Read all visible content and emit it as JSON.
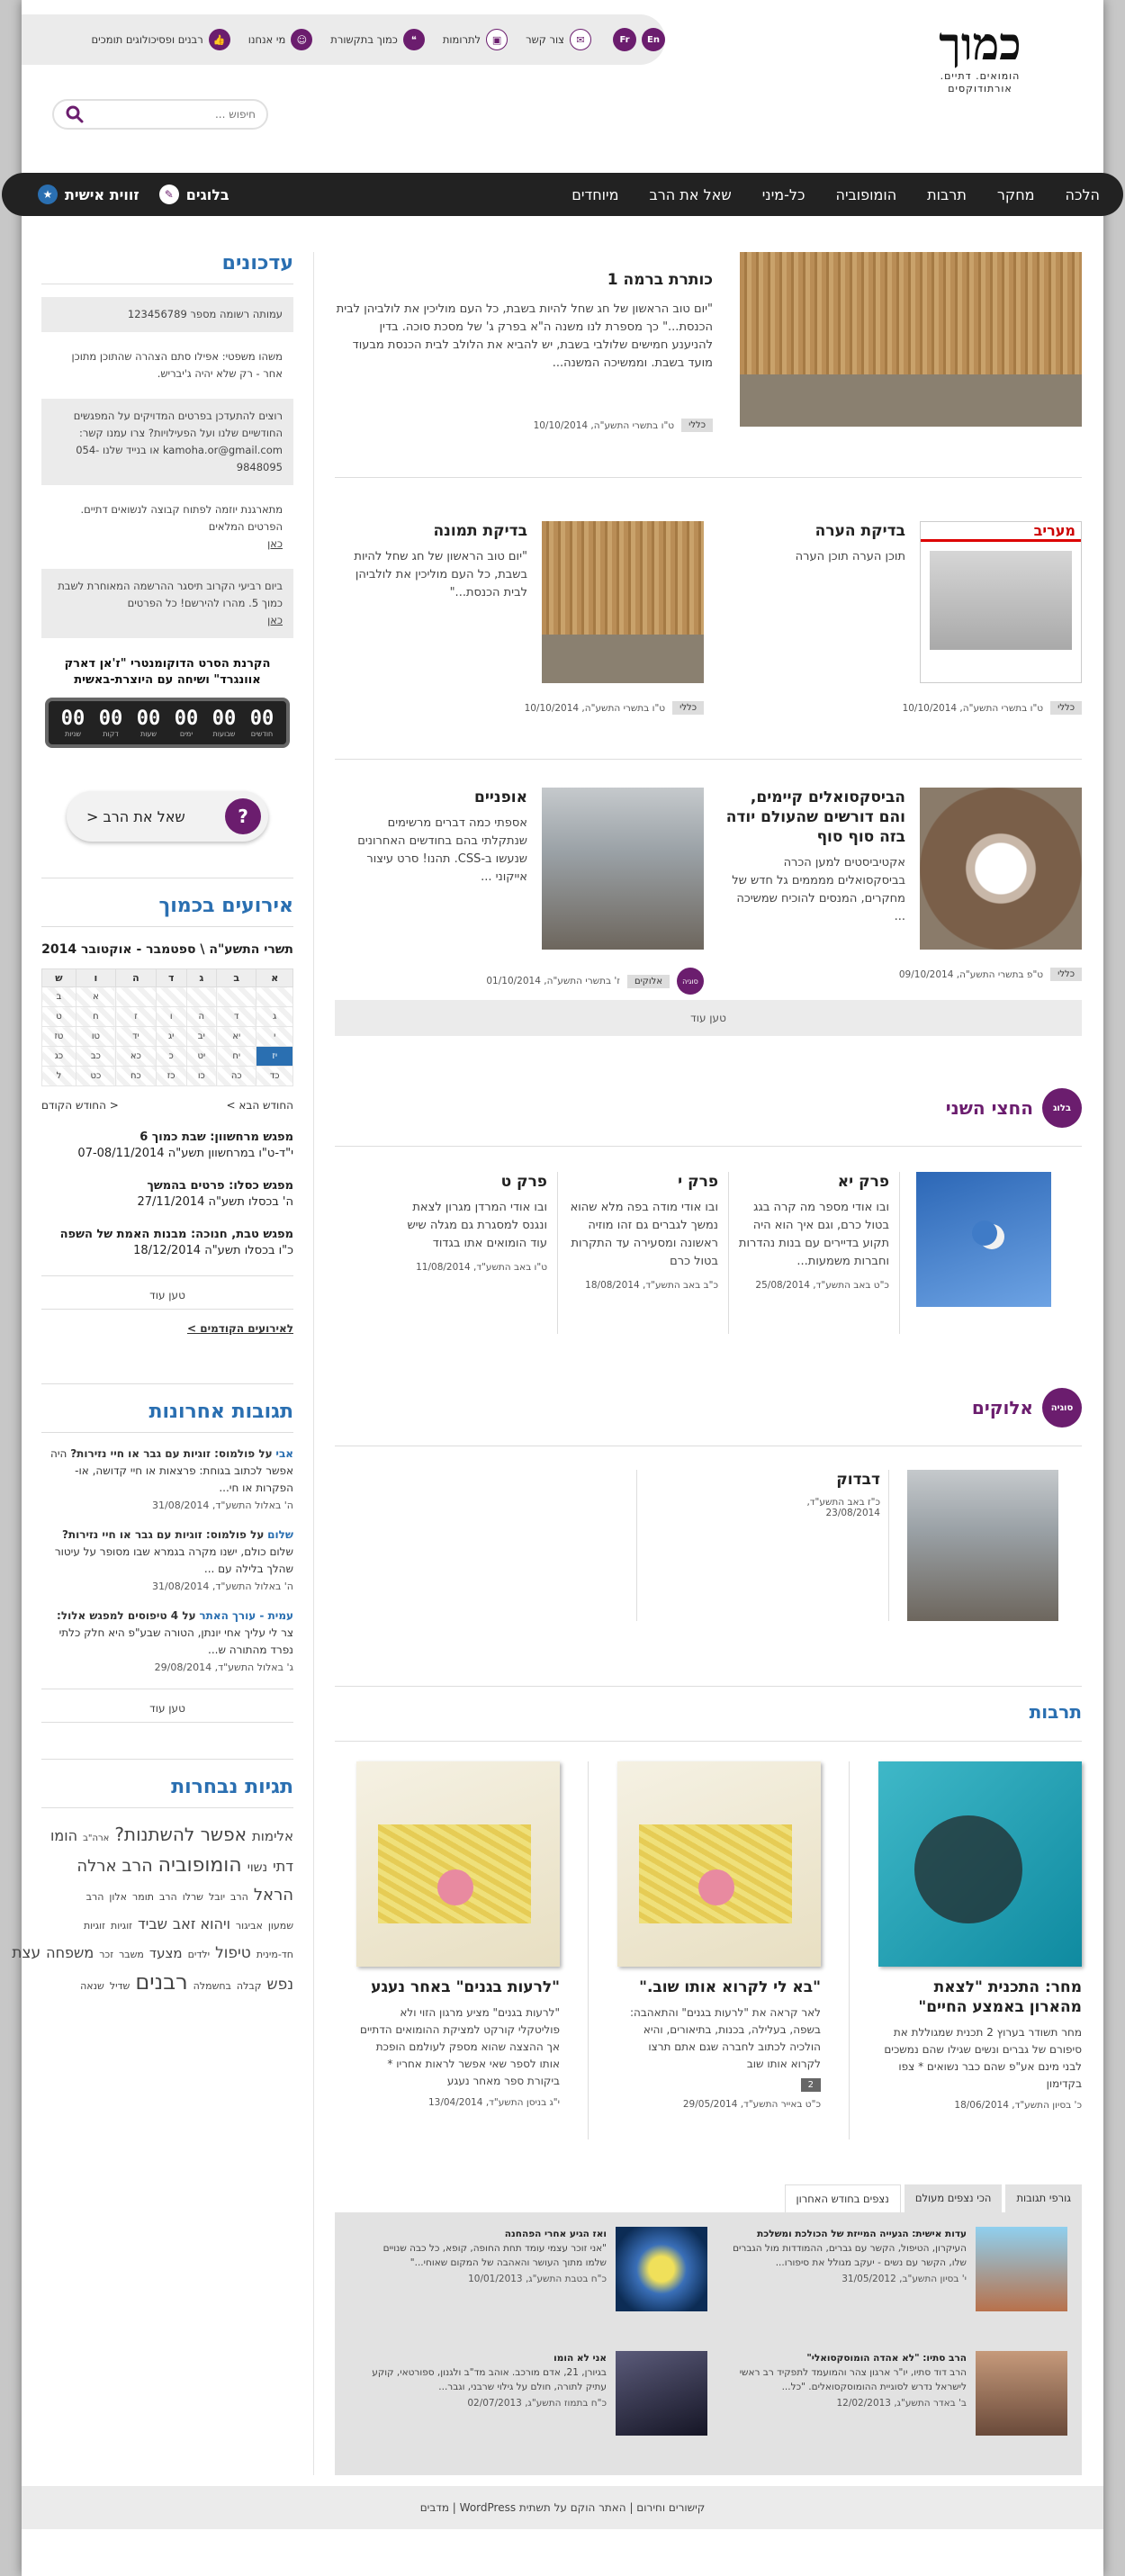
{
  "header": {
    "logo_title": "כמוך",
    "logo_subtitle": "הומואים. דתיים. אורתודוקסים",
    "links": [
      {
        "label": "רבנים ופסיכולוגים תומכים",
        "icon": "thumbs-up-icon"
      },
      {
        "label": "מי אנחנו",
        "icon": "person-icon"
      },
      {
        "label": "כמוך בתקשורת",
        "icon": "quote-icon"
      },
      {
        "label": "לתרומות",
        "icon": "gift-icon"
      },
      {
        "label": "צור קשר",
        "icon": "mail-icon"
      }
    ],
    "langs": [
      "En",
      "Fr"
    ],
    "search_placeholder": "חיפוש ..."
  },
  "nav": {
    "items": [
      "הלכה",
      "מחקר",
      "תרבות",
      "הומופוביה",
      "כל-מיני",
      "שאל את הרב",
      "מיוחדים"
    ],
    "blogs": "בלוגים",
    "personal": "זווית אישית"
  },
  "sidebar": {
    "updates_title": "עדכונים",
    "updates": [
      {
        "text": "עמותה רשומה מספר 123456789",
        "grey": true
      },
      {
        "text": "משהו משפטי: אפילו סתם הצהרה שהתוכן מתוכן אחר - רק שלא יהיה ג'יבריש.",
        "grey": false
      },
      {
        "text": "רוצים להתעדכן בפרטים המדויקים על המפגשים החודשיים שלנו ועל הפעילויות? צרו עמנו קשר: kamoha.or@gmail.com או בנייד שלנו 054-9848095",
        "grey": true
      },
      {
        "text": "מתארגנת יוזמה לפתוח קבוצה לנשואים דתיים. הפרטים המלאים",
        "link": "כאן",
        "grey": false
      },
      {
        "text": "ביום רביעי הקרוב תיסגר ההרשמה המאוחרת לשבת כמוך 5. מהרו להירשם! כל הפרטים",
        "link": "כאן",
        "grey": true
      }
    ],
    "countdown_title": "הקרנת הסרט הדוקומנטרי \"ז'אן דארק אוונגרד\" ושיחה עם היוצרת-באשית",
    "countdown": [
      {
        "n": "00",
        "l": "שניות"
      },
      {
        "n": "00",
        "l": "דקות"
      },
      {
        "n": "00",
        "l": "שעות"
      },
      {
        "n": "00",
        "l": "ימים"
      },
      {
        "n": "00",
        "l": "שבועות"
      },
      {
        "n": "00",
        "l": "חודשים"
      }
    ],
    "ask_rabbi": "שאל את הרב <",
    "ask_icon": "?",
    "events_title": "אירועים בכמוך",
    "calendar_title": "תשרי התשע\"ה \\ ספטמבר - אוקטובר 2014",
    "calendar_head": [
      "א",
      "ב",
      "ג",
      "ד",
      "ה",
      "ו",
      "ש"
    ],
    "calendar_rows": [
      [
        "",
        "",
        "",
        "",
        "",
        "א",
        "ב"
      ],
      [
        "ג",
        "ד",
        "ה",
        "ו",
        "ז",
        "ח",
        "ט"
      ],
      [
        "י",
        "יא",
        "יב",
        "יג",
        "יד",
        "טו",
        "טז"
      ],
      [
        "יז",
        "יח",
        "יט",
        "כ",
        "כא",
        "כב",
        "כג"
      ],
      [
        "כד",
        "כה",
        "כו",
        "כז",
        "כח",
        "כט",
        "ל"
      ]
    ],
    "calendar_next": "החודש הבא >",
    "calendar_prev": "< החודש הקודם",
    "events": [
      {
        "title": "מפגש מרחשוון: שבת כמוך 6",
        "date": "י\"ד-ט\"ו במרחשוון תשע\"ה 07-08/11/2014"
      },
      {
        "title": "מפגש כסלו: פרטים בהמשך",
        "date": "ה' בכסלו תשע\"ה 27/11/2014"
      },
      {
        "title": "מפגש טבת, חנוכה: מבנות האמת של השפה",
        "date": "כ\"ו בכסלו תשע\"ה 18/12/2014"
      }
    ],
    "load_more": "טען עוד",
    "prev_events": "לאירועים הקודמים >",
    "comments_title": "תגובות אחרונות",
    "comments": [
      {
        "author": "אבי",
        "on": "על פולמוס: זוגיות עם גבר או חיי נזירות?",
        "text": "היה אפשר לכתוב בגוחת: פרצאות או חיי קדושה, או- הפקרות או חי...",
        "date": "ה' באלול התשע\"ד, 31/08/2014"
      },
      {
        "author": "שלום",
        "on": "על פולמוס: זוגיות עם גבר או חיי נזירות?",
        "text": "שלום כולם, ישנו מקרה בגמרא שבו מסופר על עיטור שהלך בלילה עם ...",
        "date": "ה' באלול התשע\"ד, 31/08/2014"
      },
      {
        "author": "עמית - עורך האתר",
        "on": "על 4 טיפוסים למפגש אלול:",
        "text": "צר לי עליך אחי יונתן, הטורה שבע\"פ היא חלק כלתי נפרד מהתורה ש...",
        "date": "ג' באלול התשע\"ד, 29/08/2014"
      }
    ],
    "tags_title": "תגיות נבחרות",
    "tags": [
      {
        "t": "אלימות",
        "s": 15
      },
      {
        "t": "אפשר להשתנות?",
        "s": 20
      },
      {
        "t": "ארה\"ב",
        "s": 10
      },
      {
        "t": "הומו דתי",
        "s": 16
      },
      {
        "t": "נשוי",
        "s": 14
      },
      {
        "t": "הומופוביה",
        "s": 22
      },
      {
        "t": "הרב",
        "s": 19
      },
      {
        "t": "ארלה הראל",
        "s": 18
      },
      {
        "t": "הרב",
        "s": 11
      },
      {
        "t": "יובל",
        "s": 11
      },
      {
        "t": "שרלו",
        "s": 11
      },
      {
        "t": "הרב",
        "s": 11
      },
      {
        "t": "תומר",
        "s": 11
      },
      {
        "t": "אלון",
        "s": 11
      },
      {
        "t": "הרב שמעון",
        "s": 11
      },
      {
        "t": "אביגור",
        "s": 11
      },
      {
        "t": "ויהוא זאב",
        "s": 16
      },
      {
        "t": "שביד",
        "s": 16
      },
      {
        "t": "זוגיות",
        "s": 11
      },
      {
        "t": "זוגיות חד-מינית",
        "s": 11
      },
      {
        "t": "טיפול",
        "s": 17
      },
      {
        "t": "ילדים",
        "s": 11
      },
      {
        "t": "מצעד",
        "s": 15
      },
      {
        "t": "משבר",
        "s": 11
      },
      {
        "t": "זכר",
        "s": 11
      },
      {
        "t": "משפחה",
        "s": 16
      },
      {
        "t": "עצת נפש",
        "s": 17
      },
      {
        "t": "קבלה",
        "s": 11
      },
      {
        "t": "בחשמלה",
        "s": 11
      },
      {
        "t": "רבנים",
        "s": 24
      },
      {
        "t": "שדיל",
        "s": 11
      },
      {
        "t": "שנאה",
        "s": 11
      }
    ]
  },
  "main": {
    "featured": {
      "title": "כותרת ברמה 1",
      "excerpt": "\"יום טוב הראשון של חג שחל להיות בשבת, כל העם מוליכין את לולביהן לבית הכנסת...\" כך מספרת לנו משנה ה\"א בפרק ג' של מסכת סוכה. בדין להניענע חמישים שלולבי בשבת, יש להביא את הלולב לבית הכנסת מבעוד מועד בשבת. וממשיכה המשנה...",
      "cat": "כללי",
      "date": "ט\"ו בתשרי התשע\"ה, 10/10/2014"
    },
    "posts": [
      {
        "title": "בדיקת הערה",
        "excerpt": "תוכן הערה תוכן הערה",
        "cat": "כללי",
        "date": "ט\"ו בתשרי התשע\"ה, 10/10/2014",
        "img": "paper"
      },
      {
        "title": "בדיקת תמונה",
        "excerpt": "\"יום טוב הראשון של חג שחל להיות בשבת, כל העם מוליכין את לולביהן לבית הכנסת...\"",
        "cat": "כללי",
        "date": "ט\"ו בתשרי התשע\"ה, 10/10/2014",
        "img": "sukkah"
      },
      {
        "title": "הביסקסואלים קיימים, והם דורשים שהעולם יודה בזה סוף סוף",
        "excerpt": "אקטיביסטים למען הכרה בביסקסואלים ממממים גל חדש של מחקרים, המנסים להוכיח שמשיכה ...",
        "cat": "כללי",
        "date": "ט\"פ בתשרי התשע\"ה, 09/10/2014",
        "img": "yinyang"
      },
      {
        "title": "אופניים",
        "excerpt": "אספתי כמה דברים מרשימים שנתקלתי בהם בחודשים האחרונים שנעשו ב-CSS. תהנו! סרט עיצור אייקוני ...",
        "cat": "אלוקים",
        "date": "ז' בתשרי התשע\"ה, 01/10/2014",
        "img": "street",
        "badge": "סוגיה"
      }
    ],
    "load_more": "טען עוד",
    "blog_badge": "בלוג",
    "blog_title": "החצי השני",
    "blog_posts": [
      {
        "title": "פרק יא",
        "excerpt": "ובו אודי מספר מה קרה בגג בטול כרם, וגם איך הוא היה תקוע בדיירים עם בנות נהדרות וחברות משמעות...",
        "date": "כ\"ט באב התשע\"ד, 25/08/2014"
      },
      {
        "title": "פרק י",
        "excerpt": "ובו אודי מודה בפה מלא שהוא נמשך לגברים גם זהו מוזיה ראשונה ומסעירה עד התקרות בטול כרם",
        "date": "כ\"ב באב התשע\"ד, 18/08/2014"
      },
      {
        "title": "פרק ט",
        "excerpt": "ובו אודי המרדן מגרון לצאת ונגנס למסגרת גם מגלה שיש עוד הומואים אתו בגדוד",
        "date": "ט\"ו באב התשע\"ד, 11/08/2014"
      }
    ],
    "sugia_badge": "סוגיה",
    "sugia_title": "אלוקים",
    "sugia_post": {
      "title": "דבדוק",
      "date": "כ\"ז באב התשע\"ד, 23/08/2014"
    },
    "culture_title": "תרבות",
    "culture": [
      {
        "title": "מחר: התכנית \"לצאת מהארון באמצע החיים\"",
        "excerpt": "מחר תשודר בערוץ 2 תכנית שמגוללת את סיפורם של גברים ונשים שגילו שהם נמשכים לבני מינם אע\"פ שהם כבר נשואים * צפו בקדימון",
        "date": "כ' בסיון התשע\"ד, 18/06/2014",
        "img": "teal"
      },
      {
        "title": "\"בא לי לקרוא אותו שוב.\"",
        "excerpt": "לאר קראה את \"לרעות בגנים\" והתאהבה: בשפה, בעלילה, בכנות, בתיאורים, והיא הולכיה לכתוב לחברה שגם אתם תרצו לקרוא אותו שוב",
        "date": "כ\"ט באייר התשע\"ד, 29/05/2014",
        "img": "book",
        "count": "2"
      },
      {
        "title": "\"לרעות בגנים\" באחר נעגע",
        "excerpt": "\"לרעות בגנים\" מציע מרגון הזוי ולא פוליטקלי קורקט למציקת ההומואים הדתיים אך ההצצה שהוא מספק לעולמם הופכת אותו לספר שאי אפשר לראות אחריו * ביקורת ספר מאחר נעגע",
        "date": "י\"ג בניסן התשע\"ד, 13/04/2014",
        "img": "book"
      }
    ],
    "tabs": [
      "גורפי תגובות",
      "הכי נצפים מעולם",
      "נצפים בחודש האחרון"
    ],
    "tab_items": [
      {
        "title": "עדות אישית: הגעייה המייזת של הכולכת ומשלכת",
        "text": "העיקרון, הטיפול, הקשר עם גברים, ההמודדות מול הגברים שלו, הקשר עם נשים - יעקב מגולל את סיפורו...",
        "date": "י' בסיון התשע\"ב, 31/05/2012",
        "img": "tower"
      },
      {
        "title": "ואז הגיע אחרי הפהחנה",
        "text": "\"אני זוכר עצמי עומד תחת החופה, קופא, כל כבה שנויים שלמו מתוך העושר והאהבה של המקום שאוחי...\"",
        "date": "כ\"ח בטבת התשע\"ג, 10/01/2013",
        "img": "swirl"
      },
      {
        "title": "הרב סתיו: \"לא אהדה הומוסקסואלי\"",
        "text": "הרב דוד סתיו, יו\"ר ארגון צהר והמועמד לתפקיד רב ראשי לישראל נדרש לסוגיית ההומוסקסואלים. \"כל...",
        "date": "ב' באדר התשע\"ג, 12/02/2013",
        "img": "rabbi"
      },
      {
        "title": "אני לא הומו",
        "text": "בגיורן, 21, אדם מורכב. אוהב מד\"ב ולגנון, ספורטאי, קוקע עתיק לתורה, חולם על גילוי שרבני, וגבר...",
        "date": "כ\"ח בתמוז התשע\"ג, 02/07/2013",
        "img": "dark"
      }
    ]
  },
  "footer": "קישורים וחירום | האתר הוקם על תשתית WordPress | מדבים",
  "colors": {
    "accent": "#6b1d6e",
    "link": "#2a6fb1",
    "nav": "#222222"
  }
}
